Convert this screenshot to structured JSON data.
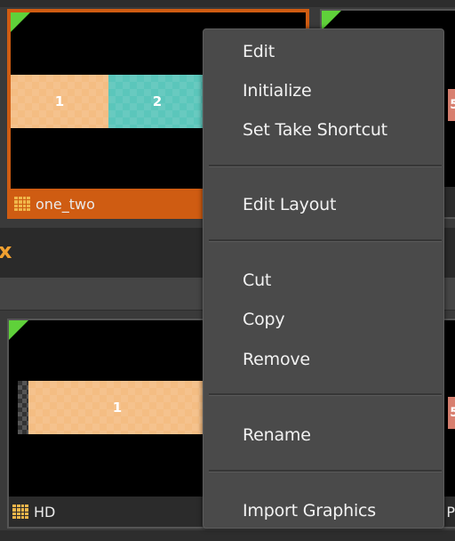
{
  "tiles": {
    "one_two": {
      "label": "one_two",
      "bar_left": "1",
      "bar_right": "2"
    },
    "hd": {
      "label": "HD",
      "bar": "1"
    },
    "right_peek_top": "5",
    "right_peek_bottom": "5",
    "right_footer_bottom": "P"
  },
  "band": {
    "x_mark": "x"
  },
  "context_menu": {
    "items": [
      {
        "label": "Edit"
      },
      {
        "label": "Initialize"
      },
      {
        "label": "Set Take Shortcut"
      },
      {
        "label": "Edit Layout"
      },
      {
        "label": "Cut"
      },
      {
        "label": "Copy"
      },
      {
        "label": "Remove"
      },
      {
        "label": "Rename"
      },
      {
        "label": "Import Graphics"
      }
    ]
  },
  "colors": {
    "selected_border": "#cf5c12",
    "corner_marker": "#5fd13a",
    "bar_orange": "#f4bd83",
    "bar_teal": "#5bc6bb",
    "menu_bg": "#4a4a4a"
  }
}
